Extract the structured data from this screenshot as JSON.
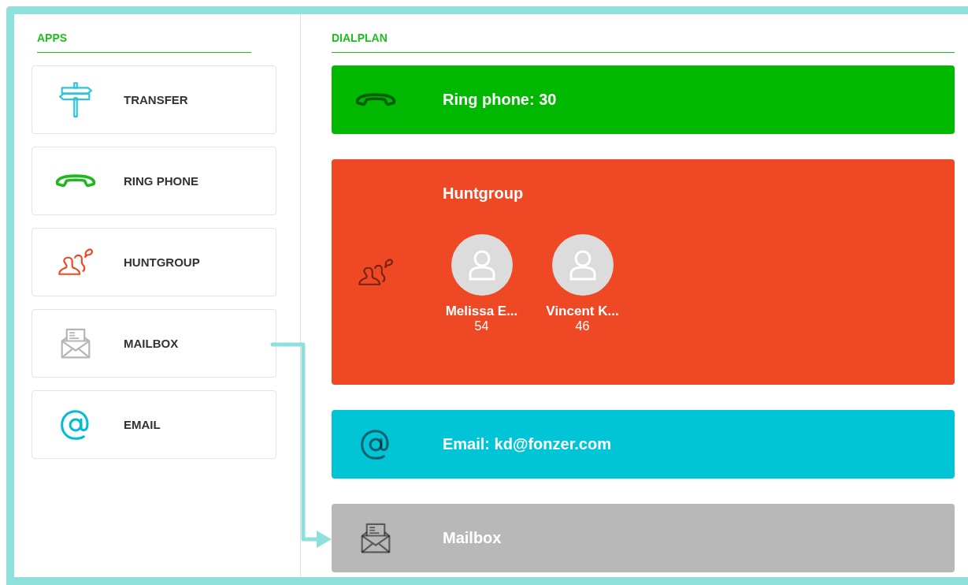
{
  "apps": {
    "title": "APPS",
    "items": [
      {
        "kind": "transfer",
        "label": "TRANSFER",
        "color": "#2ec4dc"
      },
      {
        "kind": "phone",
        "label": "RING PHONE",
        "color": "#1fb81f"
      },
      {
        "kind": "group",
        "label": "HUNTGROUP",
        "color": "#ef4824"
      },
      {
        "kind": "mail",
        "label": "MAILBOX",
        "color": "#b5b5b5"
      },
      {
        "kind": "at",
        "label": "EMAIL",
        "color": "#00bcd4"
      }
    ]
  },
  "dialplan": {
    "title": "DIALPLAN",
    "blocks": [
      {
        "kind": "phone",
        "title": "Ring phone: 30",
        "color": "#00b800"
      },
      {
        "kind": "group",
        "title": "Huntgroup",
        "color": "#ef4824",
        "members": [
          {
            "name": "Melissa E...",
            "ext": "54"
          },
          {
            "name": "Vincent K...",
            "ext": "46"
          }
        ]
      },
      {
        "kind": "at",
        "title": "Email: kd@fonzer.com",
        "color": "#00c5d6"
      },
      {
        "kind": "mail",
        "title": "Mailbox",
        "color": "#b8b8b8"
      }
    ]
  }
}
